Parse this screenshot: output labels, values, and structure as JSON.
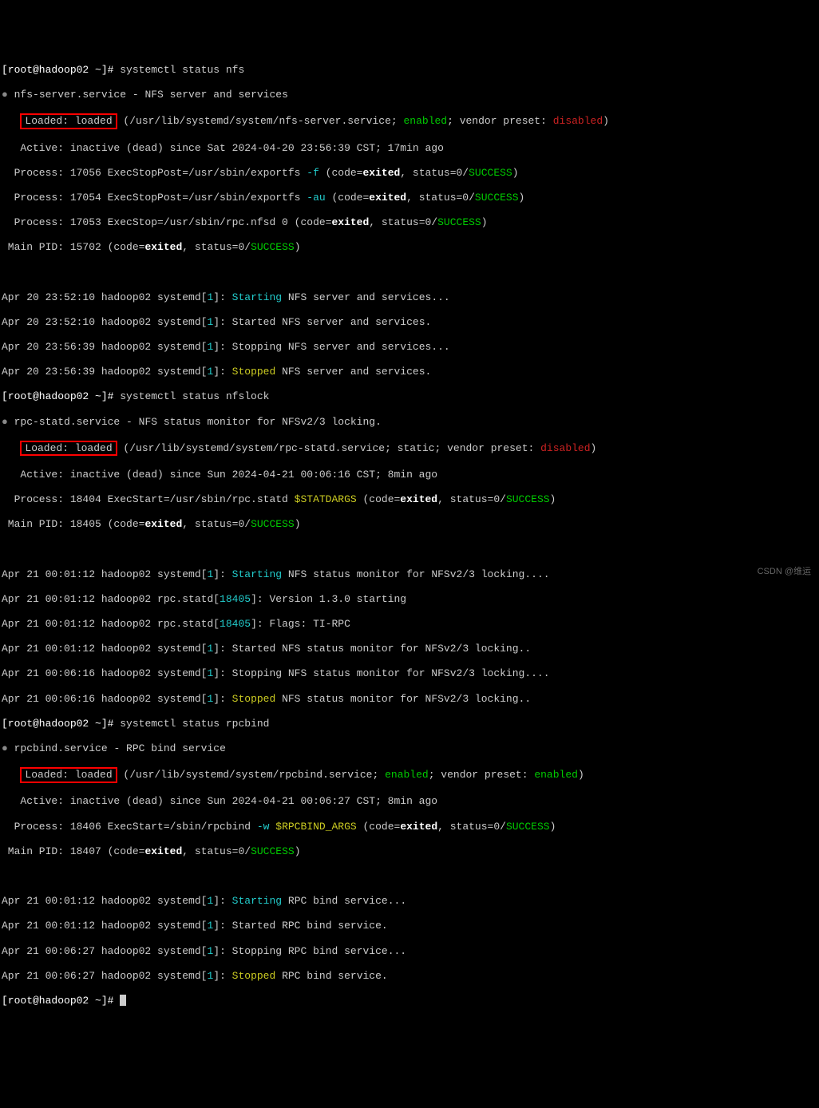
{
  "prompt1": "[root@hadoop02 ~]# ",
  "cmd1": "systemctl status nfs",
  "nfs": {
    "unit": "nfs-server.service",
    "desc": "NFS server and services",
    "loaded_label": "Loaded: loaded",
    "loaded_path": " (/usr/lib/systemd/system/nfs-server.service; ",
    "enabled": "enabled",
    "vendor_preset": "; vendor preset: ",
    "disabled": "disabled",
    "close": ")",
    "active": "   Active: inactive (dead) since Sat 2024-04-20 23:56:39 CST; 17min ago",
    "proc1a": "  Process: 17056 ExecStopPost=/usr/sbin/exportfs ",
    "proc1b": "-f",
    "proc1c": " (code=",
    "exited": "exited",
    "proc1d": ", status=0/",
    "success": "SUCCESS",
    "proc2a": "  Process: 17054 ExecStopPost=/usr/sbin/exportfs ",
    "proc2b": "-au",
    "proc3a": "  Process: 17053 ExecStop=/usr/sbin/rpc.nfsd 0 (code=",
    "mainpid": " Main PID: 15702 (code="
  },
  "nfslog": {
    "l1a": "Apr 20 23:52:10 hadoop02 systemd[",
    "one": "1",
    "l1b": "]: ",
    "starting": "Starting",
    "l1c": " NFS server and services...",
    "l2": "Apr 20 23:52:10 hadoop02 systemd[",
    "l2c": "]: Started NFS server and services.",
    "l3": "Apr 20 23:56:39 hadoop02 systemd[",
    "l3c": "]: Stopping NFS server and services...",
    "l4": "Apr 20 23:56:39 hadoop02 systemd[",
    "stopped": "Stopped",
    "l4c": " NFS server and services."
  },
  "cmd2": "systemctl status nfslock",
  "statd": {
    "unit": "rpc-statd.service",
    "desc": "NFS status monitor for NFSv2/3 locking.",
    "loaded_label": "Loaded: loaded",
    "loaded_path": " (/usr/lib/systemd/system/rpc-statd.service; static; vendor preset: ",
    "active": "   Active: inactive (dead) since Sun 2024-04-21 00:06:16 CST; 8min ago",
    "proc": "  Process: 18404 ExecStart=/usr/sbin/rpc.statd ",
    "args": "$STATDARGS",
    "mainpid": " Main PID: 18405 (code="
  },
  "statdlog": {
    "l1": "Apr 21 00:01:12 hadoop02 systemd[",
    "l1c": " NFS status monitor for NFSv2/3 locking....",
    "l2a": "Apr 21 00:01:12 hadoop02 rpc.statd[",
    "pid": "18405",
    "l2c": "]: Version 1.3.0 starting",
    "l3c": "]: Flags: TI-RPC",
    "l4": "Apr 21 00:01:12 hadoop02 systemd[",
    "l4c": "]: Started NFS status monitor for NFSv2/3 locking..",
    "l5": "Apr 21 00:06:16 hadoop02 systemd[",
    "l5c": "]: Stopping NFS status monitor for NFSv2/3 locking....",
    "l6": "Apr 21 00:06:16 hadoop02 systemd[",
    "l6c": " NFS status monitor for NFSv2/3 locking.."
  },
  "cmd3": "systemctl status rpcbind",
  "rpcbind": {
    "unit": "rpcbind.service",
    "desc": "RPC bind service",
    "loaded_label": "Loaded: loaded",
    "loaded_path": " (/usr/lib/systemd/system/rpcbind.service; ",
    "active": "   Active: inactive (dead) since Sun 2024-04-21 00:06:27 CST; 8min ago",
    "proc": "  Process: 18406 ExecStart=/sbin/rpcbind ",
    "dashw": "-w",
    "args": "$RPCBIND_ARGS",
    "mainpid": " Main PID: 18407 (code="
  },
  "rpclog": {
    "l1": "Apr 21 00:01:12 hadoop02 systemd[",
    "l1c": " RPC bind service...",
    "l2": "Apr 21 00:01:12 hadoop02 systemd[",
    "l2c": "]: Started RPC bind service.",
    "l3": "Apr 21 00:06:27 hadoop02 systemd[",
    "l3c": "]: Stopping RPC bind service...",
    "l4": "Apr 21 00:06:27 hadoop02 systemd[",
    "l4c": " RPC bind service."
  },
  "watermark": "CSDN @维运"
}
